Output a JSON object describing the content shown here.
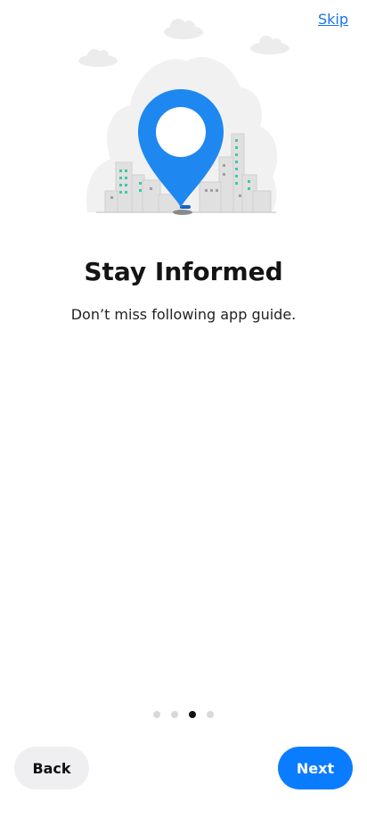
{
  "header": {
    "skip_label": "Skip"
  },
  "hero": {
    "illustration": "location-pin-city-illustration"
  },
  "content": {
    "title": "Stay Informed",
    "subtitle": "Don’t miss following app guide."
  },
  "pager": {
    "total_pages": 4,
    "current_page": 3
  },
  "footer": {
    "back_label": "Back",
    "next_label": "Next"
  },
  "colors": {
    "accent": "#0a7cff",
    "pin": "#1e88f0",
    "link": "#1a73e8",
    "secondary_button": "#efeff2",
    "dot_inactive": "#d9d9d9",
    "dot_active": "#111111",
    "city_windows": "#3ec9a7"
  }
}
